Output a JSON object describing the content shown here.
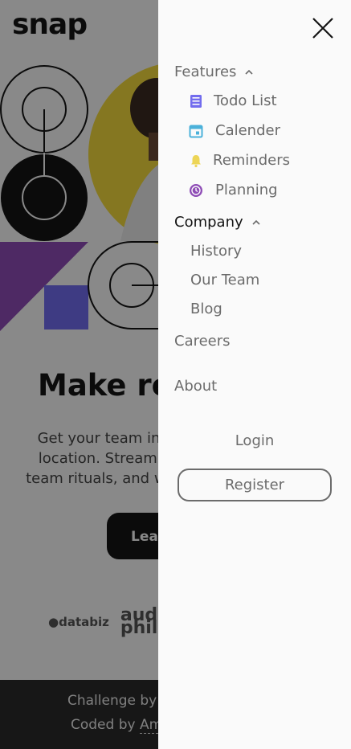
{
  "brand": {
    "logo_text": "snap"
  },
  "hero": {
    "title": "Make remote work",
    "description_lines": [
      "Get your team in sync, no matter your",
      "location. Streamline processes, create",
      "team rituals, and watch productivity soar."
    ],
    "cta_label": "Learn more"
  },
  "clients": {
    "logo_1": "●databiz",
    "logo_2_line1": "audio",
    "logo_2_line2": "phile"
  },
  "footer": {
    "line1": "Challenge by Frontend Mentor.",
    "line2_prefix": "Coded by ",
    "line2_name": "Am"
  },
  "drawer": {
    "features": {
      "label": "Features",
      "items": [
        {
          "label": "Todo List",
          "icon": "todo-list-icon",
          "color": "#726cee"
        },
        {
          "label": "Calender",
          "icon": "calendar-icon",
          "color": "#4bb1da"
        },
        {
          "label": "Reminders",
          "icon": "bell-icon",
          "color": "#edd556"
        },
        {
          "label": "Planning",
          "icon": "clock-icon",
          "color": "#8e4cb6"
        }
      ]
    },
    "company": {
      "label": "Company",
      "items": [
        {
          "label": "History"
        },
        {
          "label": "Our Team"
        },
        {
          "label": "Blog"
        }
      ]
    },
    "careers_label": "Careers",
    "about_label": "About",
    "login_label": "Login",
    "register_label": "Register"
  },
  "colors": {
    "text_dark": "#141414",
    "text_muted": "#6b6b6b",
    "background": "#fafafa",
    "overlay": "rgba(0,0,0,0.45)"
  }
}
